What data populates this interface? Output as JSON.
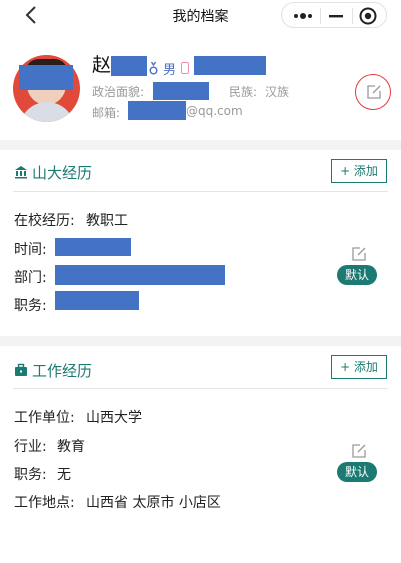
{
  "nav": {
    "title": "我的档案",
    "back_icon": "chevron-left-icon",
    "more_icon": "more-dots-icon",
    "minimize_icon": "minimize-icon",
    "close_icon": "target-close-icon"
  },
  "profile": {
    "surname": "赵",
    "gender": "男",
    "political_label": "政治面貌:",
    "ethnicity_label": "民族:",
    "ethnicity_value": "汉族",
    "email_label": "邮箱:",
    "email_suffix": "@qq.com",
    "redaction_color": "#4472c4",
    "edit_ring_color": "#e43a3a"
  },
  "sections": [
    {
      "title": "山大经历",
      "icon": "university-icon",
      "add_label": "+ 添加",
      "rows": [
        {
          "label": "在校经历:",
          "value": "教职工"
        },
        {
          "label": "时间:",
          "value": ""
        },
        {
          "label": "部门:",
          "value": ""
        },
        {
          "label": "职务:",
          "value": ""
        }
      ],
      "badge": "默认"
    },
    {
      "title": "工作经历",
      "icon": "briefcase-icon",
      "add_label": "+ 添加",
      "rows": [
        {
          "label": "工作单位:",
          "value": "山西大学"
        },
        {
          "label": "行业:",
          "value": "教育"
        },
        {
          "label": "职务:",
          "value": "无"
        },
        {
          "label": "工作地点:",
          "value": "山西省 太原市 小店区"
        }
      ],
      "badge": "默认"
    }
  ],
  "theme": {
    "accent": "#1b7a72",
    "divider": "#f3f3f3"
  }
}
